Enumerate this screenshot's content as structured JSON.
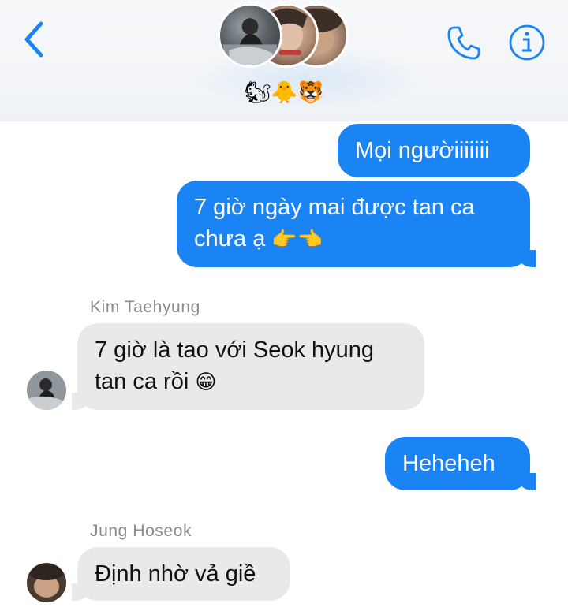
{
  "header": {
    "back_icon": "chevron-left-icon",
    "group_emojis": "🐿🐥🐯",
    "call_icon": "phone-icon",
    "info_icon": "info-icon",
    "accent_color": "#1b84f5"
  },
  "messages": [
    {
      "id": "m1",
      "direction": "outgoing",
      "text": "Mọi ngườiiiiiii"
    },
    {
      "id": "m2",
      "direction": "outgoing",
      "line1": "7 giờ ngày mai được tan ca",
      "line2": "chưa ạ",
      "emoji": "👉👈"
    },
    {
      "id": "m3",
      "direction": "incoming",
      "sender": "Kim Taehyung",
      "line1": "7 giờ là tao với Seok hyung",
      "line2": "tan ca rồi",
      "emoji": "😁"
    },
    {
      "id": "m4",
      "direction": "outgoing",
      "text": "Heheheh"
    },
    {
      "id": "m5",
      "direction": "incoming",
      "sender": "Jung Hoseok",
      "text": "Định nhờ vả giề"
    }
  ],
  "colors": {
    "outgoing_bubble": "#1b84f5",
    "incoming_bubble": "#e9e9eb",
    "sender_name": "#8a8a8e"
  }
}
